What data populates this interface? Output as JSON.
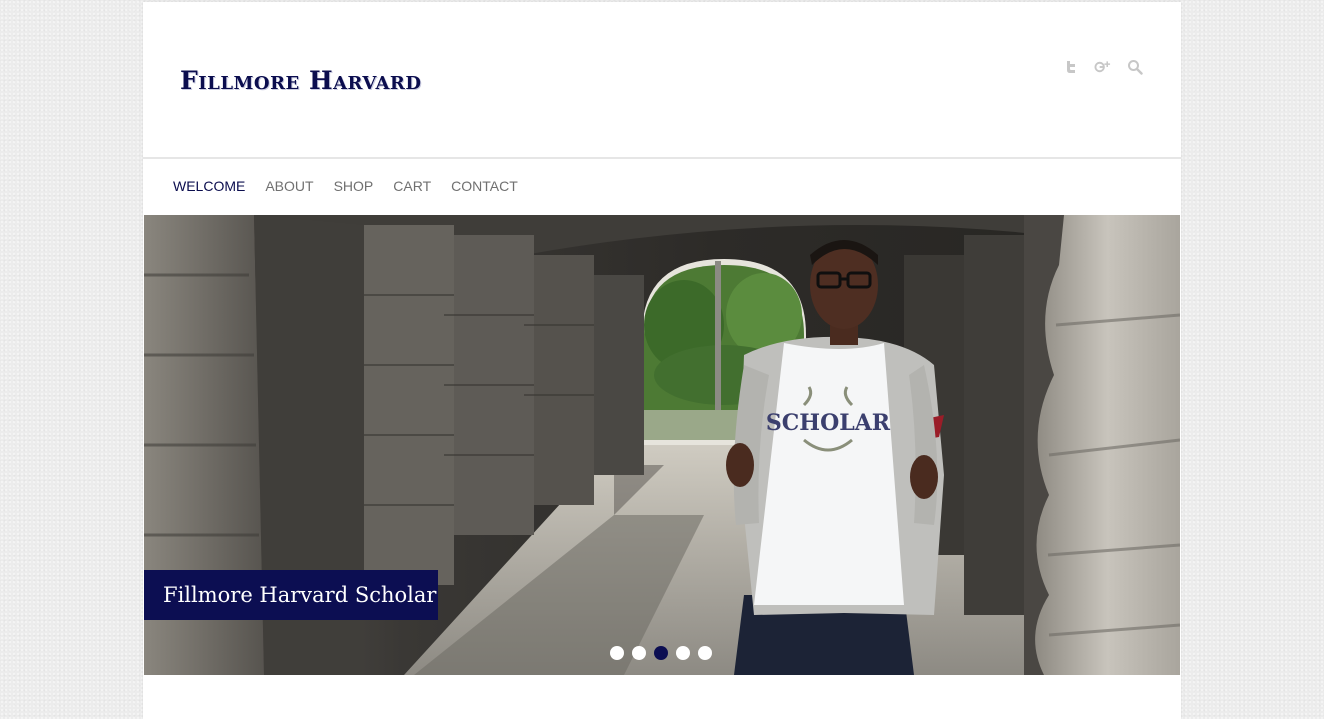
{
  "brand": {
    "logo_text": "Fillmore Harvard",
    "color": "#0b0d4e"
  },
  "social": [
    {
      "name": "twitter-icon"
    },
    {
      "name": "google-plus-icon"
    },
    {
      "name": "search-icon"
    }
  ],
  "nav": {
    "items": [
      {
        "label": "WELCOME",
        "active": true
      },
      {
        "label": "ABOUT",
        "active": false
      },
      {
        "label": "SHOP",
        "active": false
      },
      {
        "label": "CART",
        "active": false
      },
      {
        "label": "CONTACT",
        "active": false
      }
    ]
  },
  "slider": {
    "caption": "Fillmore Harvard Scholar",
    "shirt_text": "SCHOLAR",
    "slide_count": 5,
    "active_index": 2,
    "caption_bg": "#0c0e52"
  }
}
